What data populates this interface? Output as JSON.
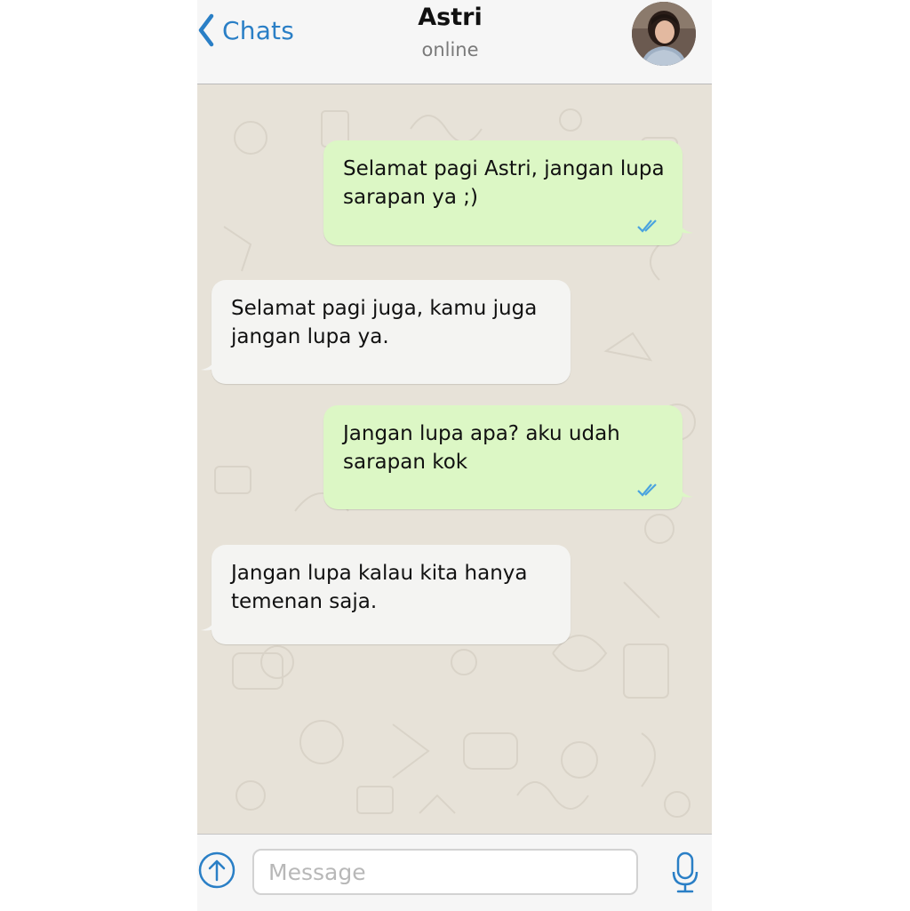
{
  "header": {
    "back_label": "Chats",
    "contact_name": "Astri",
    "contact_status": "online"
  },
  "messages": [
    {
      "direction": "outgoing",
      "text": "Selamat pagi Astri, jangan lupa\nsarapan ya ;)",
      "status": "read"
    },
    {
      "direction": "incoming",
      "text": "Selamat pagi juga, kamu juga\njangan lupa ya."
    },
    {
      "direction": "outgoing",
      "text": "Jangan lupa apa? aku udah\nsarapan kok",
      "status": "read"
    },
    {
      "direction": "incoming",
      "text": "Jangan lupa kalau kita hanya\ntemenan saja."
    }
  ],
  "composer": {
    "placeholder": "Message",
    "value": ""
  },
  "icons": {
    "back": "chevron-left-icon",
    "attach": "upload-arrow-icon",
    "mic": "microphone-icon",
    "read": "double-check-icon"
  },
  "colors": {
    "accent": "#2a7fc6",
    "outgoing_bubble": "#dcf7c5",
    "incoming_bubble": "#f4f4f2",
    "chat_background": "#e7e2d8"
  }
}
